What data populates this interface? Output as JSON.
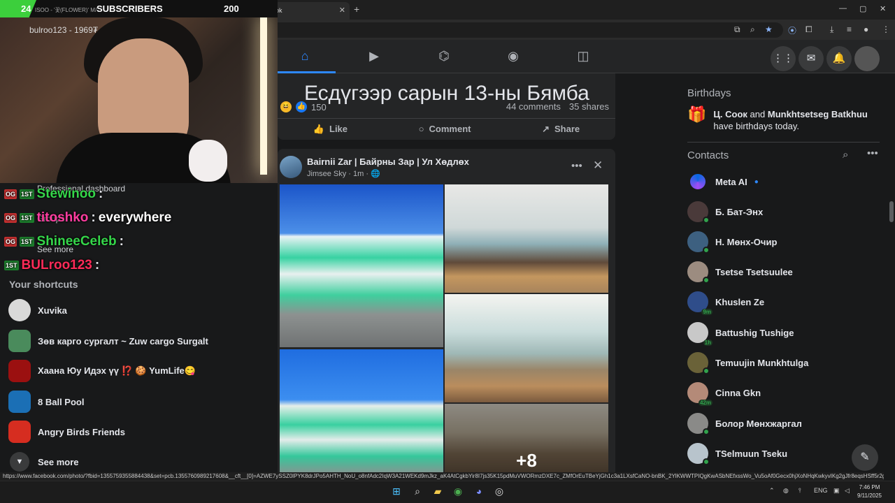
{
  "browser": {
    "tab_title": "Facebook",
    "tab_favicon": "f",
    "new_tab": "+",
    "tab_close": "✕",
    "window_buttons": [
      "—",
      "▢",
      "✕"
    ],
    "status_url": "https://www.facebook.com/photo/?fbid=1355759355884438&set=pcb.1355760989217608&__cft__[0]=AZWE7ySSZ0lPYK8drJPo5AHTH_NoU_o8nfAdc2IqW3A21WEKd9mJkz_aK4AtCgkbYir8I7js35K15pdMuVWORmzDXE7c_ZMfOrEuTBeYjGh1c3a1LXsfCaNO-bnBK_2YlKWWTPIQgKwASbNEfxssWo_Vu5oAf0Gecx0hjXoNHqKwkyvIKg2gJfr8eqsHSff5r2gbFD3Ev..."
  },
  "stream": {
    "sub_count": "24",
    "sub_label": "SUBSCRIBERS",
    "sub_goal": "200",
    "song_fragment": "ISOO - '꽃(FLOWER)' M/",
    "cam_user": "bulroo123 - 1969₮",
    "chat": [
      {
        "user": "Stewinoo",
        "sep": ":",
        "msg": "",
        "color": "#35d64a"
      },
      {
        "user": "titoshko",
        "sep": ":",
        "msg": "everywhere",
        "color": "#ff3da0"
      },
      {
        "user": "ShineeCeleb",
        "sep": ":",
        "msg": "",
        "color": "#35d64a"
      },
      {
        "user": "BULroo123",
        "sep": ":",
        "msg": "",
        "color": "#ff2b58"
      }
    ],
    "badge_og": "OG",
    "badge_1st": "1ST"
  },
  "left": {
    "ghost_dashboard": "Professional dashboard",
    "ghost_groups": "Groups",
    "ghost_seemore": "See more",
    "shortcuts_title": "Your shortcuts",
    "shortcuts": [
      {
        "label": "Xuvika"
      },
      {
        "label": "Зөв карго сургалт ~ Zuw cargo Surgalt"
      },
      {
        "label": "Хаана Юу Идэх үү ⁉️ 🍪 YumLife😋"
      },
      {
        "label": "8 Ball Pool"
      },
      {
        "label": "Angry Birds Friends"
      }
    ],
    "see_more": "See more"
  },
  "feed": {
    "prev_title": "Есдүгээр сарын 13-ны Бямба",
    "reaction_count": "150",
    "comments": "44 comments",
    "shares": "35 shares",
    "like": "Like",
    "comment": "Comment",
    "share": "Share",
    "post_title": "Bairnii Zar | Байрны Зар | Ул Хөдлөх",
    "post_author": "Jimsee Sky",
    "post_time": "1m",
    "more_photos": "+8"
  },
  "right": {
    "birthdays_title": "Birthdays",
    "bday_name1": "Ц. Соок",
    "bday_and": "and",
    "bday_name2": "Munkhtsetseg Batkhuu",
    "bday_suffix": "have birthdays today.",
    "contacts_title": "Contacts",
    "contacts": [
      {
        "name": "Meta AI",
        "status": ""
      },
      {
        "name": "Б. Бат-Энх",
        "status": "online"
      },
      {
        "name": "Н. Мөнх-Очир",
        "status": "online"
      },
      {
        "name": "Tsetse Tsetsuulee",
        "status": "online"
      },
      {
        "name": "Khuslen Ze",
        "status": "9m"
      },
      {
        "name": "Battushig Tushige",
        "status": "1h"
      },
      {
        "name": "Temuujin Munkhtulga",
        "status": "online"
      },
      {
        "name": "Cinna Gkn",
        "status": "42m"
      },
      {
        "name": "Болор Мөнхжаргал",
        "status": "online"
      },
      {
        "name": "TSelmuun Tseku",
        "status": "online"
      }
    ]
  },
  "taskbar": {
    "lang": "ENG",
    "time": "7:46 PM",
    "date": "9/11/2025"
  },
  "colors": {
    "fb_blue": "#2d88ff",
    "online": "#31a24c",
    "surface": "#242526",
    "background": "#18191a"
  }
}
